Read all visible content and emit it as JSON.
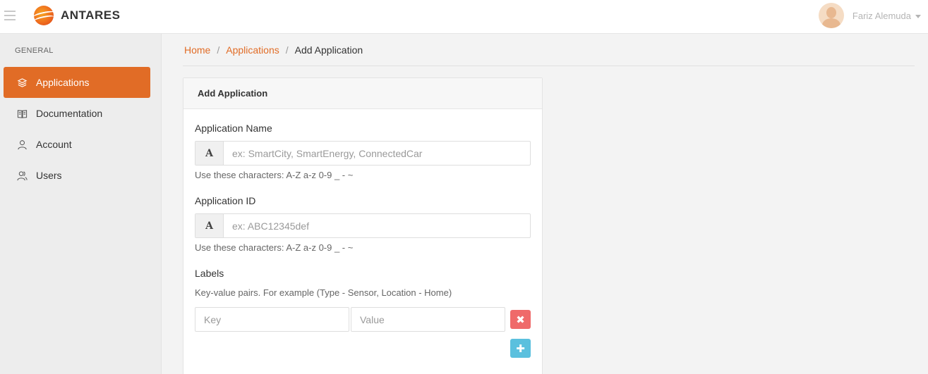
{
  "header": {
    "brand": "ANTARES",
    "user_name": "Fariz Alemuda",
    "icons": {
      "menu": "hamburger-icon",
      "logo": "antares-logo",
      "avatar": "user-avatar",
      "caret": "caret-down-icon"
    }
  },
  "sidebar": {
    "heading": "GENERAL",
    "items": [
      {
        "label": "Applications",
        "icon": "layers-icon",
        "active": true
      },
      {
        "label": "Documentation",
        "icon": "book-icon",
        "active": false
      },
      {
        "label": "Account",
        "icon": "user-icon",
        "active": false
      },
      {
        "label": "Users",
        "icon": "users-icon",
        "active": false
      }
    ]
  },
  "breadcrumb": {
    "home": "Home",
    "applications": "Applications",
    "current": "Add Application",
    "separator": "/"
  },
  "form": {
    "title": "Add Application",
    "app_name": {
      "label": "Application Name",
      "addon": "A",
      "placeholder": "ex: SmartCity, SmartEnergy, ConnectedCar",
      "value": "",
      "help": "Use these characters: A-Z a-z 0-9 _ - ~"
    },
    "app_id": {
      "label": "Application ID",
      "addon": "A",
      "placeholder": "ex: ABC12345def",
      "value": "",
      "help": "Use these characters: A-Z a-z 0-9 _ - ~"
    },
    "labels": {
      "label": "Labels",
      "help": "Key-value pairs. For example (Type - Sensor, Location - Home)",
      "key_placeholder": "Key",
      "value_placeholder": "Value",
      "remove_symbol": "✖",
      "add_symbol": "✚"
    }
  },
  "colors": {
    "accent": "#e16c26",
    "danger": "#ef6a6a",
    "info": "#5bc0de"
  }
}
